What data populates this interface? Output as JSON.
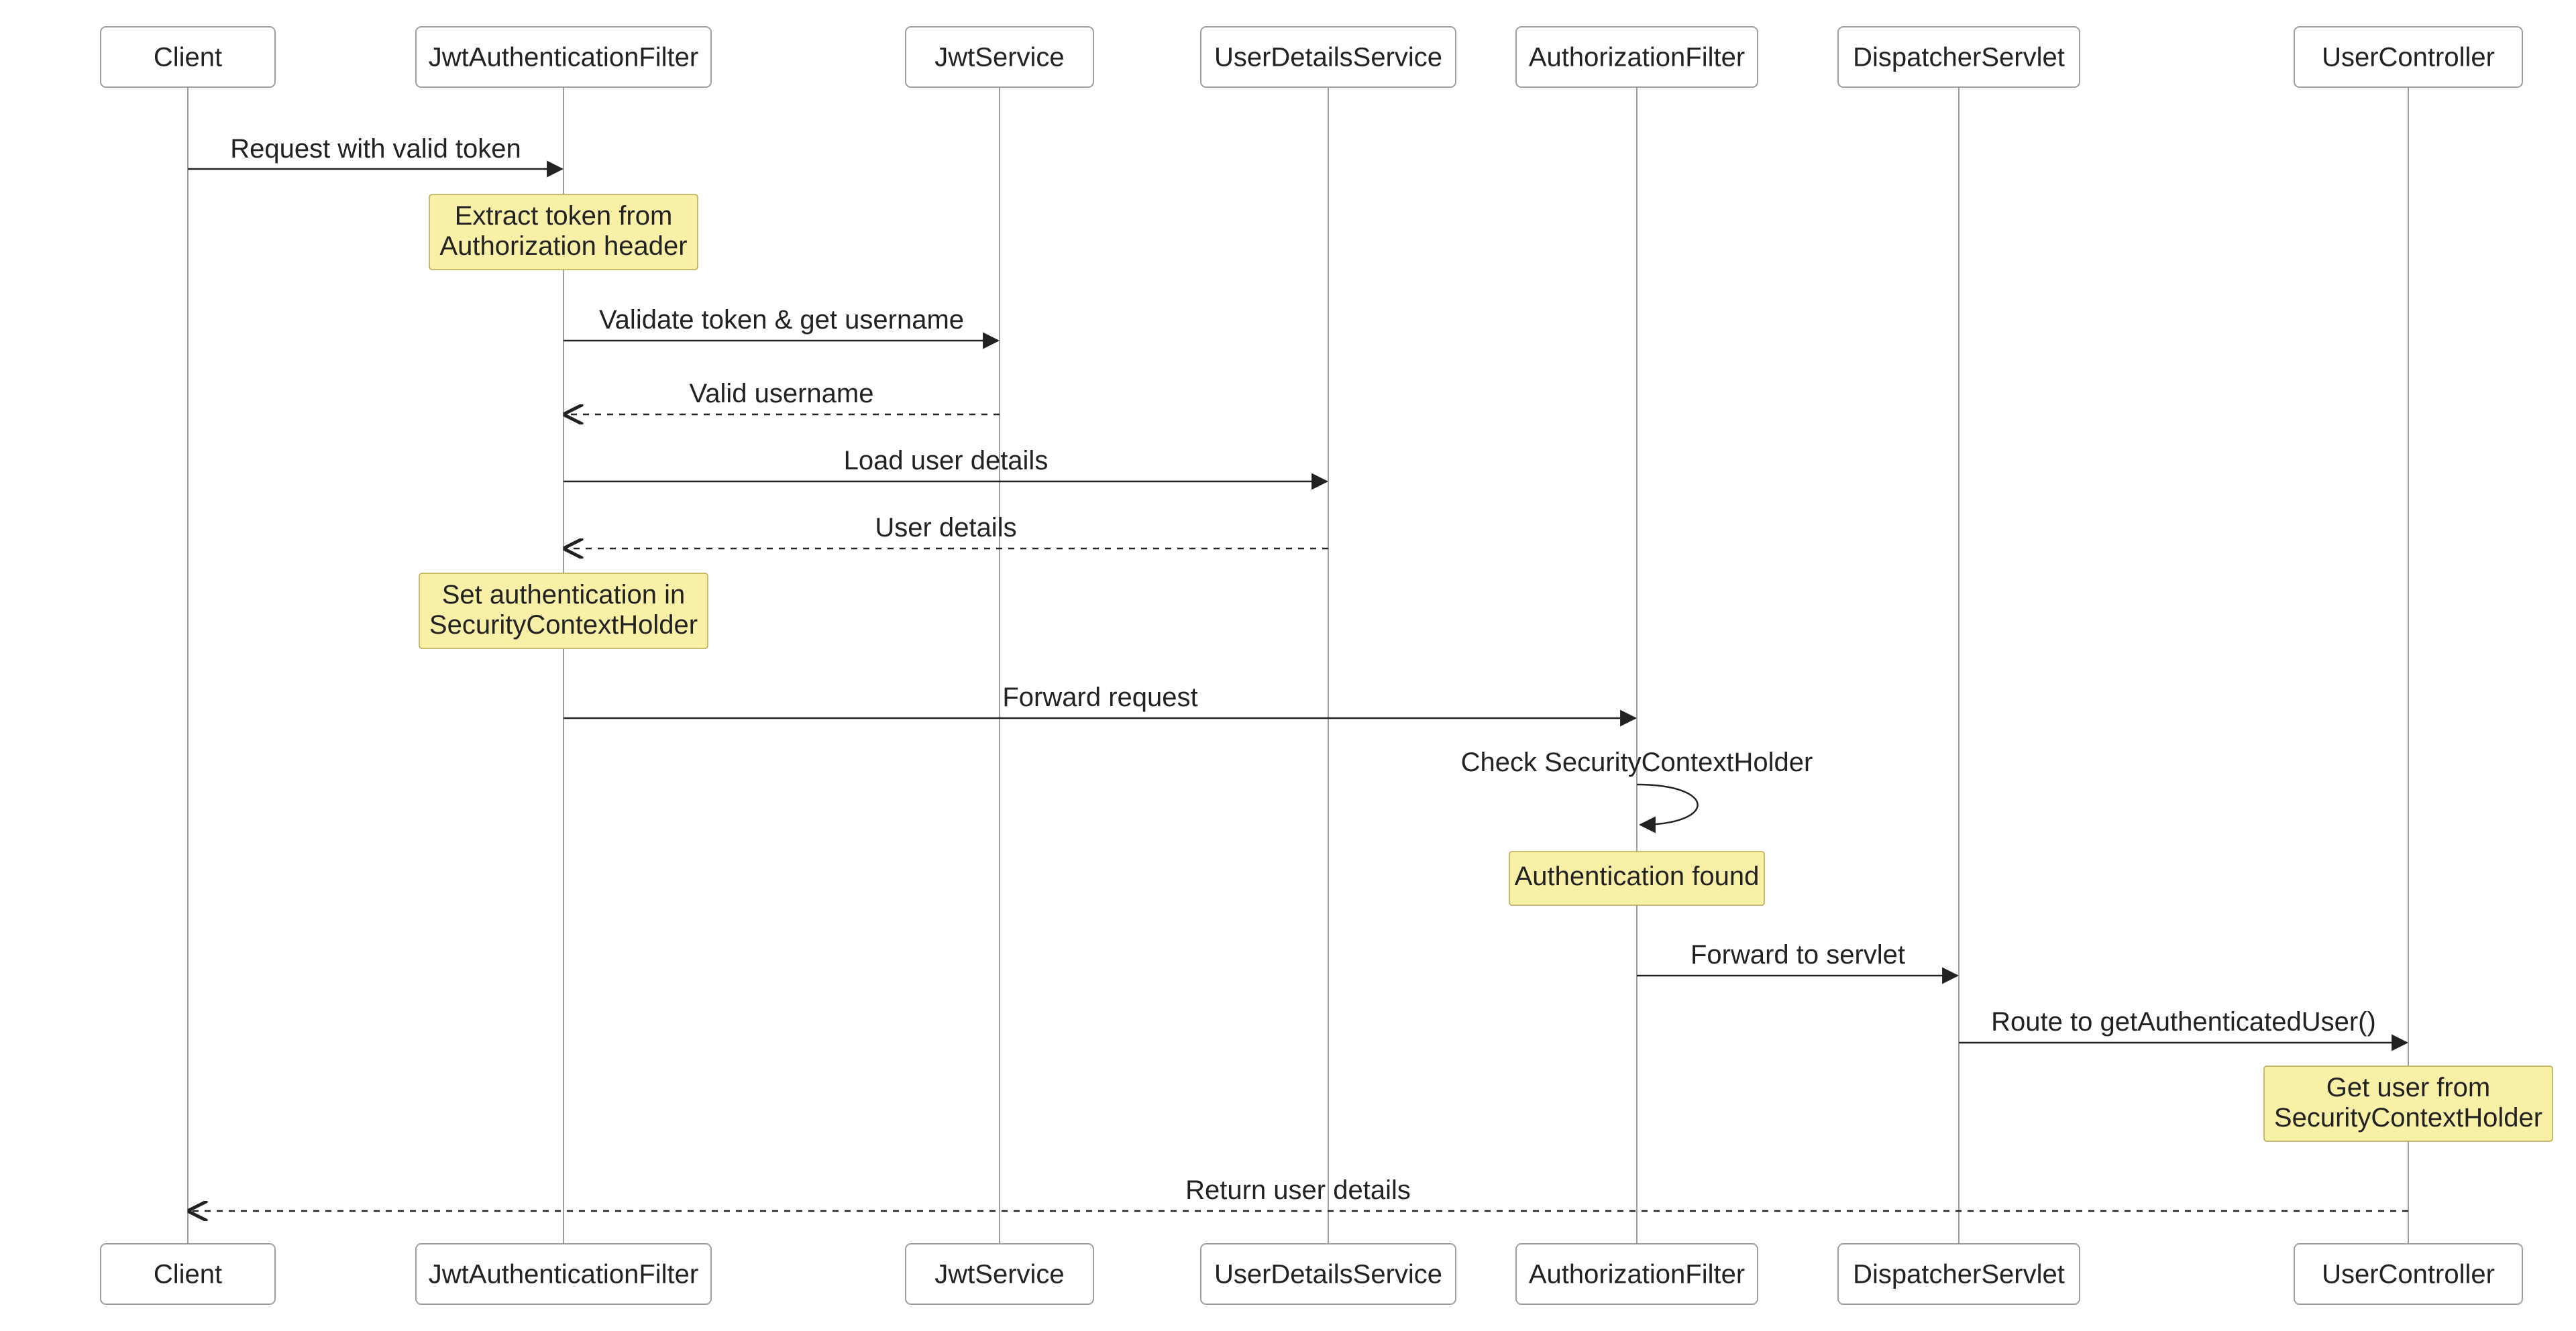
{
  "diagram_type": "sequence",
  "actors": [
    {
      "id": "client",
      "label": "Client"
    },
    {
      "id": "jwtFilter",
      "label": "JwtAuthenticationFilter"
    },
    {
      "id": "jwtService",
      "label": "JwtService"
    },
    {
      "id": "userDetails",
      "label": "UserDetailsService"
    },
    {
      "id": "authFilter",
      "label": "AuthorizationFilter"
    },
    {
      "id": "dispatcher",
      "label": "DispatcherServlet"
    },
    {
      "id": "controller",
      "label": "UserController"
    }
  ],
  "messages": {
    "m1": "Request with valid token",
    "m2": "Validate token & get username",
    "m3": "Valid username",
    "m4": "Load user details",
    "m5": "User details",
    "m6": "Forward request",
    "m7": "Check SecurityContextHolder",
    "m8": "Forward to servlet",
    "m9": "Route to getAuthenticatedUser()",
    "m10": "Return user details"
  },
  "notes": {
    "n1a": "Extract token from",
    "n1b": "Authorization header",
    "n2a": "Set authentication in",
    "n2b": "SecurityContextHolder",
    "n3": "Authentication found",
    "n4a": "Get user from",
    "n4b": "SecurityContextHolder"
  }
}
